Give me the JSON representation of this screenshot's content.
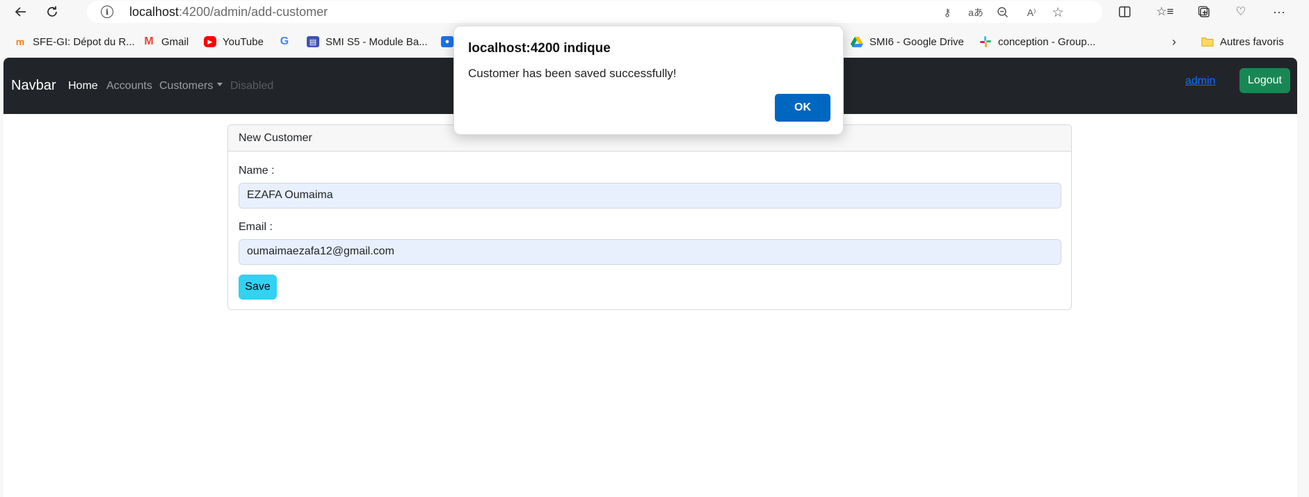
{
  "browser": {
    "url_host": "localhost",
    "url_path": ":4200/admin/add-customer",
    "bookmarks": [
      {
        "label": "SFE-GI: Dépot du R..."
      },
      {
        "label": "Gmail"
      },
      {
        "label": "YouTube"
      },
      {
        "label": ""
      },
      {
        "label": "SMI S5 - Module Ba..."
      },
      {
        "label": ""
      },
      {
        "label": "SMI6 - Google Drive"
      },
      {
        "label": "conception - Group..."
      },
      {
        "label": "Autres favoris"
      }
    ],
    "icons": {
      "back": "back-arrow-icon",
      "reload": "reload-icon",
      "info": "info-icon",
      "key": "key-icon",
      "translate": "translate-icon",
      "zoom": "zoom-out-icon",
      "read_aloud": "read-aloud-icon",
      "favorite": "star-icon"
    }
  },
  "navbar": {
    "brand": "Navbar",
    "links": {
      "home": "Home",
      "accounts": "Accounts",
      "customers": "Customers",
      "disabled": "Disabled"
    },
    "user": "admin",
    "logout": "Logout"
  },
  "form": {
    "header": "New Customer",
    "name_label": "Name :",
    "name_value": "EZAFA Oumaima",
    "email_label": "Email :",
    "email_value": "oumaimaezafa12@gmail.com",
    "save_label": "Save"
  },
  "dialog": {
    "title": "localhost:4200 indique",
    "message": "Customer has been saved successfully!",
    "ok_label": "OK"
  },
  "colors": {
    "navbar_bg": "#212529",
    "logout_btn": "#198754",
    "save_btn": "#31d2f2",
    "ok_btn": "#0067c0",
    "input_bg": "#e8f0fe"
  }
}
